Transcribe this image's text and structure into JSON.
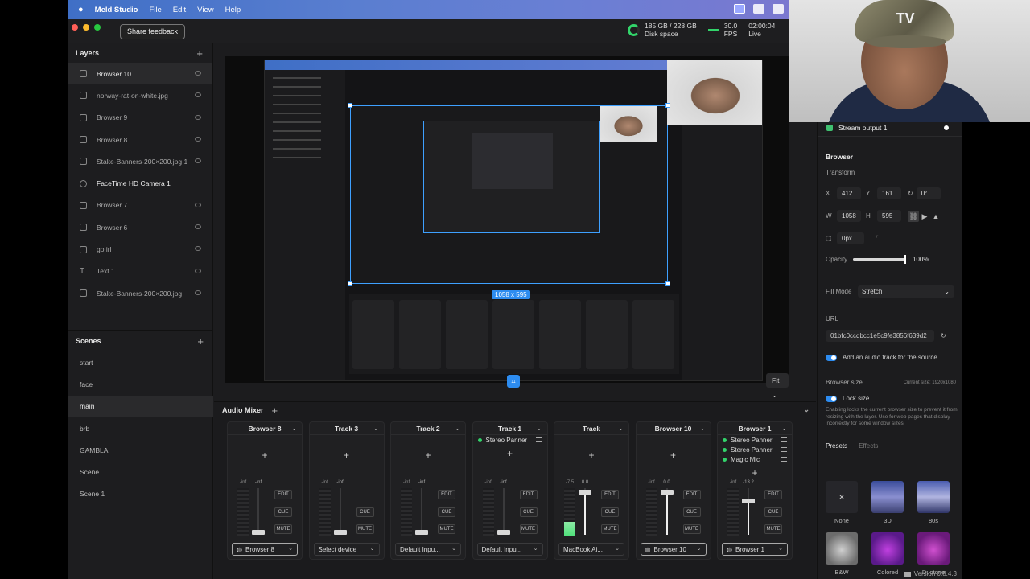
{
  "menubar": {
    "app_name": "Meld Studio",
    "items": [
      "File",
      "Edit",
      "View",
      "Help"
    ]
  },
  "titlebar": {
    "feedback_label": "Share feedback",
    "disk_value": "185 GB / 228 GB",
    "disk_label": "Disk space",
    "fps_value": "30.0",
    "fps_label": "FPS",
    "live_time": "02:00:04",
    "live_label": "Live"
  },
  "layers": {
    "title": "Layers",
    "items": [
      {
        "label": "Browser 10",
        "icon": "globe-icon"
      },
      {
        "label": "norway-rat-on-white.jpg",
        "icon": "image-icon"
      },
      {
        "label": "Browser 9",
        "icon": "globe-icon"
      },
      {
        "label": "Browser 8",
        "icon": "globe-icon"
      },
      {
        "label": "Stake-Banners-200×200.jpg 1",
        "icon": "image-icon"
      },
      {
        "label": "FaceTime HD Camera 1",
        "icon": "camera-icon"
      },
      {
        "label": "Browser 7",
        "icon": "globe-icon"
      },
      {
        "label": "Browser 6",
        "icon": "globe-icon"
      },
      {
        "label": "go irl",
        "icon": "globe-icon"
      },
      {
        "label": "Text 1",
        "icon": "text-icon"
      },
      {
        "label": "Stake-Banners-200×200.jpg",
        "icon": "image-icon"
      }
    ]
  },
  "scenes": {
    "title": "Scenes",
    "items": [
      "start",
      "face",
      "main",
      "brb",
      "GAMBLA",
      "Scene",
      "Scene 1"
    ]
  },
  "canvas": {
    "selection_size": "1058 x 595",
    "fit_label": "Fit"
  },
  "mixer": {
    "title": "Audio Mixer",
    "strips": [
      {
        "name": "Browser 8",
        "effects": [],
        "meter_label": "-inf",
        "fader_label": "-inf",
        "level": 0,
        "fader": 0.05,
        "source": "Browser 8",
        "source_icon": true,
        "edit": "EDIT",
        "cue": "CUE",
        "mute": "MUTE"
      },
      {
        "name": "Track 3",
        "effects": [],
        "meter_label": "-inf",
        "fader_label": "-inf",
        "level": 0,
        "fader": 0.05,
        "source": "Select device",
        "source_icon": false,
        "edit": "",
        "cue": "CUE",
        "mute": "MUTE"
      },
      {
        "name": "Track 2",
        "effects": [],
        "meter_label": "-inf",
        "fader_label": "-inf",
        "level": 0,
        "fader": 0.05,
        "source": "Default Inpu...",
        "source_icon": false,
        "edit": "EDIT",
        "cue": "CUE",
        "mute": "MUTE"
      },
      {
        "name": "Track 1",
        "effects": [
          "Stereo Panner"
        ],
        "meter_label": "-inf",
        "fader_label": "-inf",
        "level": 0,
        "fader": 0.05,
        "source": "Default Inpu...",
        "source_icon": false,
        "edit": "EDIT",
        "cue": "CUE",
        "mute": "MUTE"
      },
      {
        "name": "Track",
        "effects": [],
        "meter_label": "-7.5",
        "fader_label": "0.0",
        "level": 0.3,
        "fader": 0.92,
        "source": "MacBook Ai...",
        "source_icon": false,
        "edit": "EDIT",
        "cue": "CUE",
        "mute": "MUTE"
      },
      {
        "name": "Browser 10",
        "effects": [],
        "meter_label": "-inf",
        "fader_label": "0.0",
        "level": 0,
        "fader": 0.92,
        "source": "Browser 10",
        "source_icon": true,
        "edit": "EDIT",
        "cue": "CUE",
        "mute": "MUTE"
      },
      {
        "name": "Browser 1",
        "effects": [
          "Stereo Panner",
          "Stereo Panner",
          "Magic Mic"
        ],
        "meter_label": "-inf",
        "fader_label": "-13.2",
        "level": 0,
        "fader": 0.72,
        "source": "Browser 1",
        "source_icon": true,
        "edit": "EDIT",
        "cue": "CUE",
        "mute": "MUTE"
      }
    ]
  },
  "inspector": {
    "output_label": "Stream output 1",
    "section": "Browser",
    "transform_label": "Transform",
    "x_label": "X",
    "x_value": "412",
    "y_label": "Y",
    "y_value": "161",
    "rot_value": "0°",
    "w_label": "W",
    "w_value": "1058",
    "h_label": "H",
    "h_value": "595",
    "radius_value": "0px",
    "opacity_label": "Opacity",
    "opacity_value": "100%",
    "opacity_level": 1.0,
    "fill_mode_label": "Fill Mode",
    "fill_mode_value": "Stretch",
    "url_label": "URL",
    "url_value": "01bfc0ccdbcc1e5c9fe3856f639d2",
    "audio_track_label": "Add an audio track for the source",
    "browser_size_label": "Browser size",
    "current_size": "Current size: 1920x1080",
    "lock_size_label": "Lock size",
    "lock_desc": "Enabling locks the current browser size to prevent it from resizing with the layer. Use for web pages that display incorrectly for some window sizes.",
    "tab_presets": "Presets",
    "tab_effects": "Effects",
    "presets": [
      {
        "label": "None",
        "glyph": "×"
      },
      {
        "label": "3D",
        "glyph": ""
      },
      {
        "label": "80s",
        "glyph": ""
      },
      {
        "label": "B&W",
        "glyph": ""
      },
      {
        "label": "Colored",
        "glyph": ""
      },
      {
        "label": "Duotone",
        "glyph": ""
      }
    ],
    "version": "Version 0.8.4.3"
  },
  "webcam": {
    "cap_logo": "TV"
  },
  "colors": {
    "accent": "#2d8cf0",
    "live_green": "#32d36a"
  }
}
